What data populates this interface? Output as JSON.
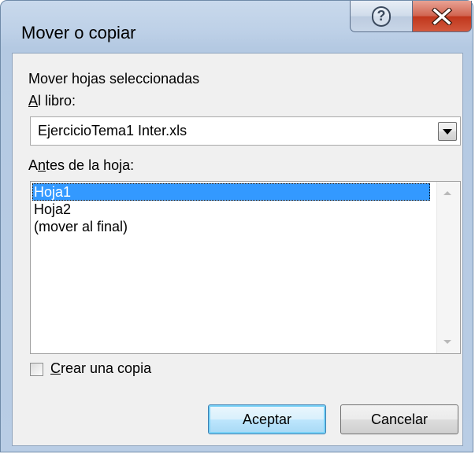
{
  "window": {
    "title": "Mover o copiar",
    "help_icon": "help-icon",
    "close_icon": "close-icon",
    "help_glyph": "?"
  },
  "content": {
    "move_label": "Mover hojas seleccionadas",
    "book_label_ul": "A",
    "book_label_rest": "l libro:",
    "book_select": {
      "value": "EjercicioTema1 Inter.xls",
      "icon": "chevron-down-icon"
    },
    "before_label_pre": "A",
    "before_label_ul": "n",
    "before_label_rest": "tes de la hoja:",
    "sheets": [
      "Hoja1",
      "Hoja2",
      "(mover al final)"
    ],
    "selected_sheet": "Hoja1",
    "copy_checkbox": {
      "checked": false,
      "label_ul": "C",
      "label_rest": "rear una copia"
    }
  },
  "buttons": {
    "ok": "Aceptar",
    "cancel": "Cancelar"
  },
  "colors": {
    "selection": "#3399ff",
    "title_bar": "#bdd0e7",
    "close_button": "#c0351b"
  }
}
